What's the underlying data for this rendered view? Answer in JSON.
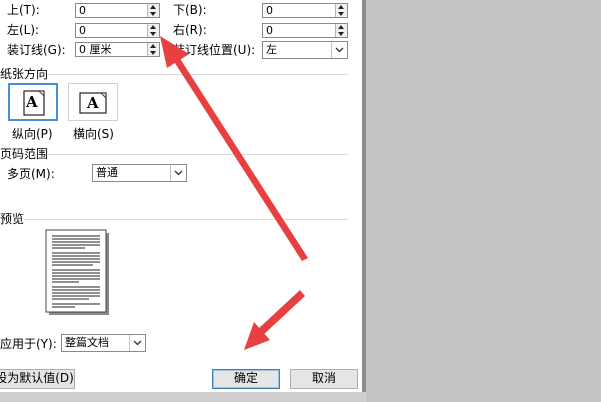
{
  "margins": {
    "top_label": "上(T):",
    "top_value": "0",
    "bottom_label": "下(B):",
    "bottom_value": "0",
    "left_label": "左(L):",
    "left_value": "0",
    "right_label": "右(R):",
    "right_value": "0",
    "gutter_label": "装订线(G):",
    "gutter_value": "0 厘米",
    "gutter_pos_label": "装订线位置(U):",
    "gutter_pos_value": "左"
  },
  "orientation": {
    "section_title": "纸张方向",
    "portrait_label": "纵向(P)",
    "landscape_label": "横向(S)",
    "icon_letter": "A"
  },
  "pages": {
    "section_title": "页码范围",
    "multiple_label": "多页(M):",
    "multiple_value": "普通"
  },
  "preview": {
    "section_title": "预览",
    "apply_label": "应用于(Y):",
    "apply_value": "整篇文档"
  },
  "buttons": {
    "default_label": "设为默认值(D)",
    "ok_label": "确定",
    "cancel_label": "取消"
  },
  "colors": {
    "annotation_arrow": "#e84040",
    "selection_border": "#4a8fd4"
  }
}
